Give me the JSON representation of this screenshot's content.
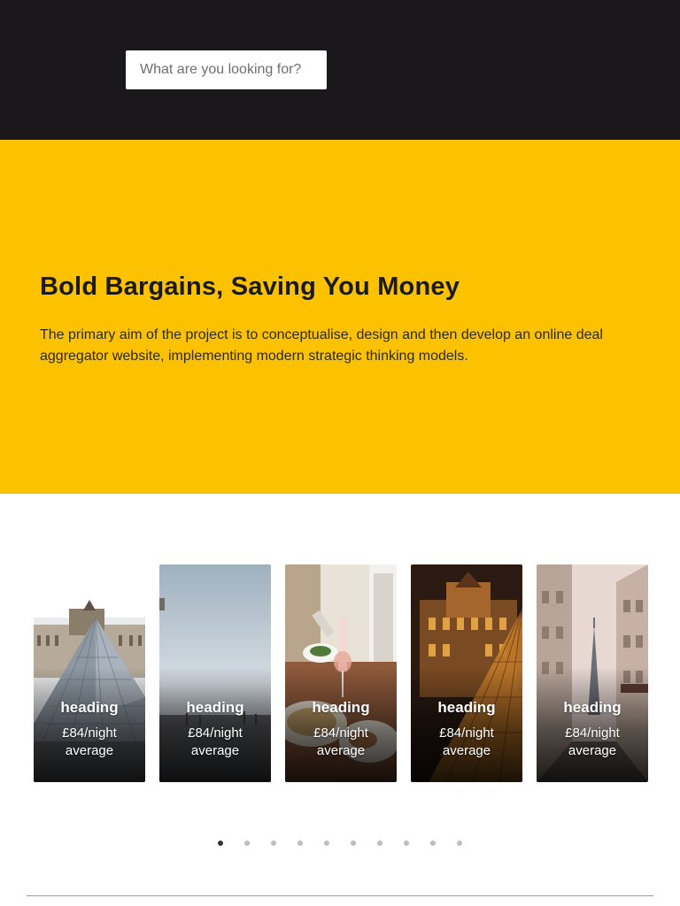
{
  "search": {
    "placeholder": "What are you looking for?"
  },
  "hero": {
    "title": "Bold Bargains, Saving You Money",
    "description": "The primary aim of the project is to conceptualise, design and then develop an online deal aggregator website, implementing modern strategic thinking models."
  },
  "colors": {
    "header_bg": "#1a181a",
    "hero_bg": "#fcc200",
    "accent_text": "#1a1a1a"
  },
  "carousel": {
    "cards": [
      {
        "heading": "heading",
        "price": "£84/night",
        "note": "average",
        "image": "louvre-pyramid-photo"
      },
      {
        "heading": "heading",
        "price": "£84/night",
        "note": "average",
        "image": "louvre-courtyard-sky-photo"
      },
      {
        "heading": "heading",
        "price": "£84/night",
        "note": "average",
        "image": "food-and-wine-table-photo"
      },
      {
        "heading": "heading",
        "price": "£84/night",
        "note": "average",
        "image": "louvre-at-night-photo"
      },
      {
        "heading": "heading",
        "price": "£84/night",
        "note": "average",
        "image": "paris-street-eiffel-photo"
      }
    ],
    "page_count": 10,
    "active_page": 1
  }
}
